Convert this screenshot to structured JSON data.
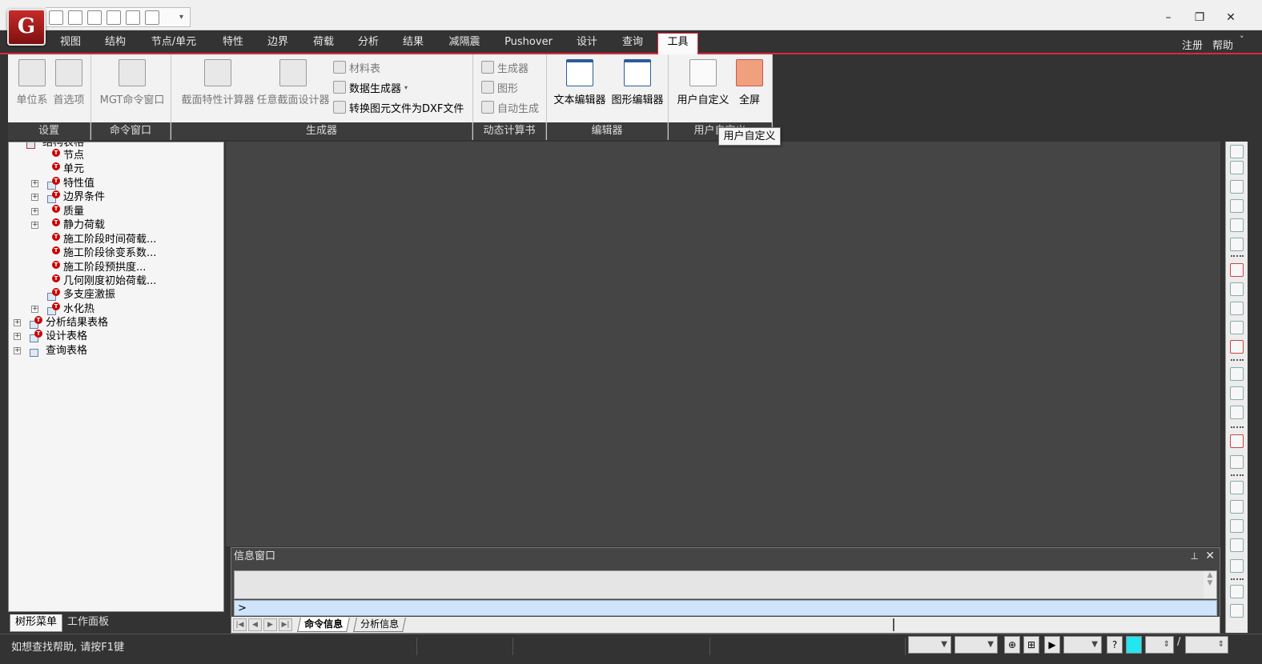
{
  "app": {
    "logo_text": "G",
    "accent_color": "#e0273a"
  },
  "quick_access": {
    "icons": [
      "new-file-icon",
      "open-file-icon",
      "import-icon",
      "save-icon",
      "print-icon",
      "print-preview-icon"
    ],
    "dropdown": "▾"
  },
  "window_controls": {
    "minimize": "–",
    "restore": "❐",
    "close": "✕"
  },
  "menu": {
    "tabs": [
      "视图",
      "结构",
      "节点/单元",
      "特性",
      "边界",
      "荷载",
      "分析",
      "结果",
      "减隔震",
      "Pushover",
      "设计",
      "查询",
      "工具"
    ],
    "active_tab": "工具",
    "register": "注册",
    "help": "帮助",
    "help_arrow": "˅"
  },
  "ribbon": {
    "groups": {
      "settings": "设置",
      "command_window": "命令窗口",
      "generator": "生成器",
      "dynamic_calc": "动态计算书",
      "editor": "编辑器",
      "user_defined": "用户自定义"
    },
    "buttons": {
      "unit_system": "单位系",
      "preferences": "首选项",
      "mgt_command": "MGT命令窗口",
      "section_calculator": "截面特性计算器",
      "any_section_designer": "任意截面设计器",
      "material_table": "材料表",
      "data_generator": "数据生成器",
      "dxf_convert": "转换图元文件为DXF文件",
      "dyn_generator": "生成器",
      "dyn_graphic": "图形",
      "dyn_auto": "自动生成",
      "text_editor": "文本编辑器",
      "graphic_editor": "图形编辑器",
      "user_defined": "用户自定义",
      "fullscreen": "全屏"
    },
    "tooltip": "用户自定义"
  },
  "tree": {
    "top_item": "结构表格",
    "children": [
      "节点",
      "单元",
      "特性值",
      "边界条件",
      "质量",
      "静力荷载",
      "施工阶段时间荷载...",
      "施工阶段徐变系数...",
      "施工阶段预拱度...",
      "几何刚度初始荷载...",
      "多支座激振",
      "水化热"
    ],
    "roots": [
      "分析结果表格",
      "设计表格",
      "查询表格"
    ],
    "tabs": [
      "树形菜单",
      "工作面板"
    ]
  },
  "message_window": {
    "title": "信息窗口",
    "pin": "⊥",
    "close": "✕",
    "prompt": ">",
    "tabs": [
      "命令信息",
      "分析信息"
    ],
    "nav": [
      "|◀",
      "◀",
      "▶",
      "▶|"
    ]
  },
  "status": {
    "help_text": "如想查找帮助, 请按F1键",
    "slash": "/",
    "question": "?"
  }
}
